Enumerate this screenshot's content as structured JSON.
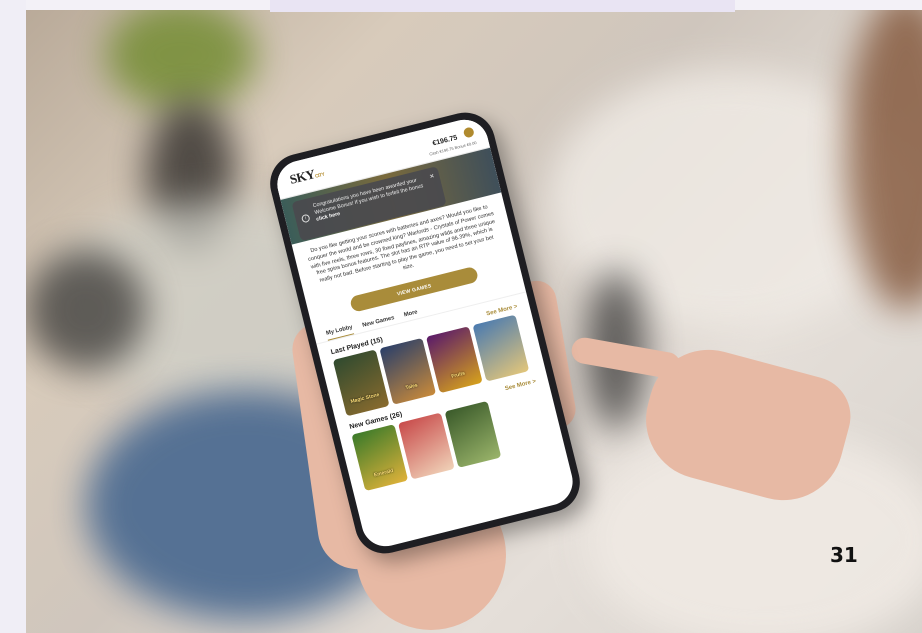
{
  "page_number": "31",
  "phone": {
    "logo_text": "SKY",
    "logo_sub": "CITY",
    "balance": "€196.75",
    "balance_detail": "Cash €196.75  Bonus €0.00",
    "toast": {
      "message": "Congratulations you have been awarded your Welcome Bonus! If you wish to forfeit the bonus",
      "link_text": "click here",
      "close_label": "×",
      "info_label": "i"
    },
    "description": "Do you like getting your scores with batteries and axes? Would you like to conquer the world and be crowned king? Warlords - Crystals of Power comes with five reels, three rows, 30 fixed paylines, amazing wilds and three unique free spins bonus features. The slot has an RTP value of 96.39%, which is really not bad. Before starting to play the game, you need to set your bet size.",
    "view_button": "VIEW GAMES",
    "tabs": [
      "My Lobby",
      "New Games",
      "More"
    ],
    "last_played": {
      "title": "Last Played (15)",
      "see_more": "See More >",
      "tiles": [
        {
          "label": "Magic Stone",
          "color_a": "#2f4a2f",
          "color_b": "#8a6b2e"
        },
        {
          "label": "Tales",
          "color_a": "#2a3f6a",
          "color_b": "#c98a3a"
        },
        {
          "label": "Fruits",
          "color_a": "#5a1a6a",
          "color_b": "#d7a21c"
        },
        {
          "label": "",
          "color_a": "#4a7ab0",
          "color_b": "#e3c67a"
        }
      ]
    },
    "new_games": {
      "title": "New Games (26)",
      "see_more": "See More >",
      "tiles": [
        {
          "label": "Emerald",
          "color_a": "#3a7a2a",
          "color_b": "#e0b23a"
        },
        {
          "label": "",
          "color_a": "#c84a4a",
          "color_b": "#f0d2b8"
        },
        {
          "label": "",
          "color_a": "#3a5a2a",
          "color_b": "#9ab46a"
        }
      ]
    }
  }
}
